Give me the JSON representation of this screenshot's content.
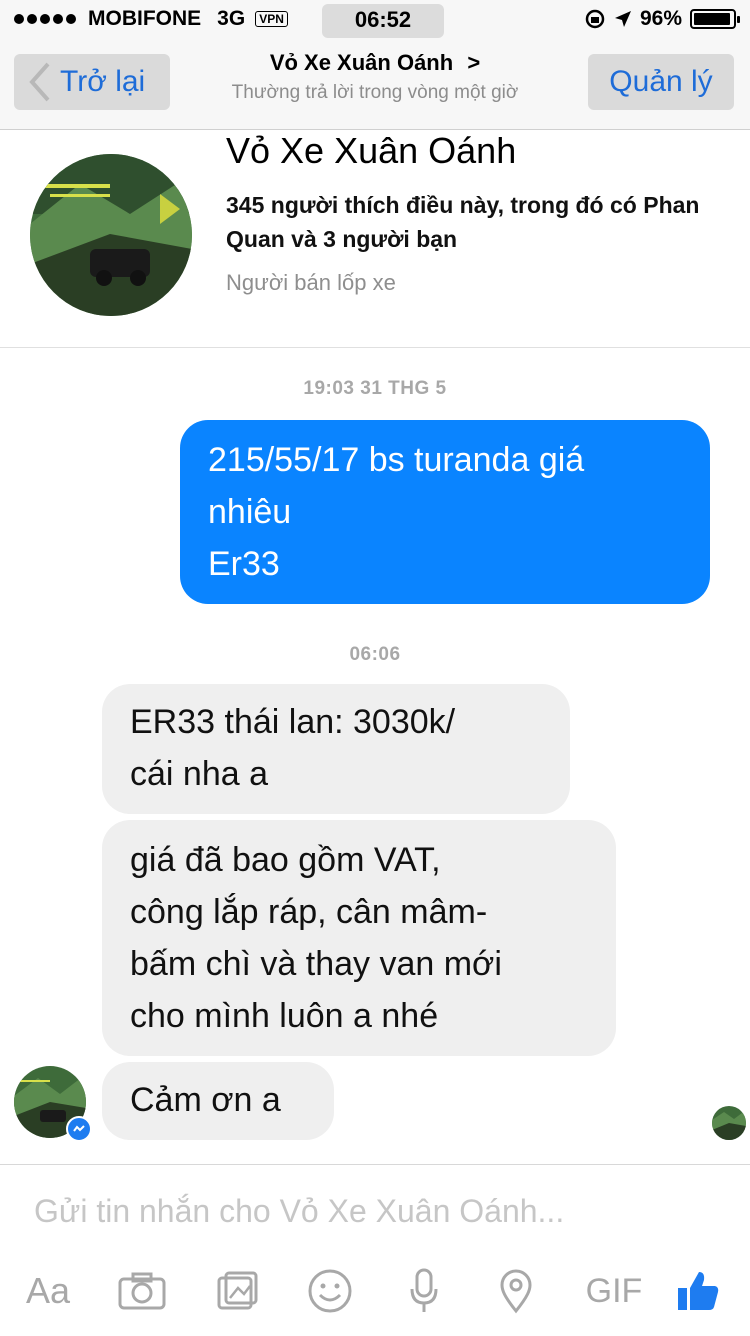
{
  "status_bar": {
    "carrier": "MOBIFONE",
    "network": "3G",
    "vpn": "VPN",
    "time": "06:52",
    "battery": "96%",
    "battery_level": 0.96
  },
  "nav": {
    "back_label": "Trở lại",
    "title": "Vỏ Xe Xuân Oánh",
    "title_chevron": ">",
    "subtitle": "Thường trả lời trong vòng một giờ",
    "manage_label": "Quản lý"
  },
  "page": {
    "name": "Vỏ Xe Xuân Oánh",
    "likes": "345 người thích điều này, trong đó có Phan Quan và 3 người bạn",
    "category": "Người bán lốp xe"
  },
  "messages": {
    "timestamp_1": "19:03 31 THG 5",
    "outgoing_1_line1": "215/55/17 bs turanda giá",
    "outgoing_1_line2": "nhiêu",
    "outgoing_1_line3": "Er33",
    "timestamp_2": "06:06",
    "incoming_1_line1": "ER33 thái lan: 3030k/",
    "incoming_1_line2": "cái nha a",
    "incoming_2_line1": "giá đã bao gồm VAT,",
    "incoming_2_line2": "công lắp ráp, cân mâm-",
    "incoming_2_line3": "bấm chì và thay van mới",
    "incoming_2_line4": "cho mình luôn a nhé",
    "incoming_3": "Cảm ơn a"
  },
  "composer": {
    "placeholder": "Gửi tin nhắn cho Vỏ Xe Xuân Oánh...",
    "aa_label": "Aa",
    "gif_label": "GIF"
  },
  "icons": [
    "signal-icon",
    "vpn-icon",
    "lock-rotation-icon",
    "location-arrow-icon",
    "battery-icon",
    "back-chevron-icon",
    "camera-icon",
    "photo-icon",
    "emoji-icon",
    "microphone-icon",
    "location-pin-icon",
    "like-icon",
    "messenger-badge-icon"
  ],
  "colors": {
    "accent": "#1e6cd8",
    "outgoing_bubble": "#0a84ff",
    "incoming_bubble": "#efefef"
  }
}
